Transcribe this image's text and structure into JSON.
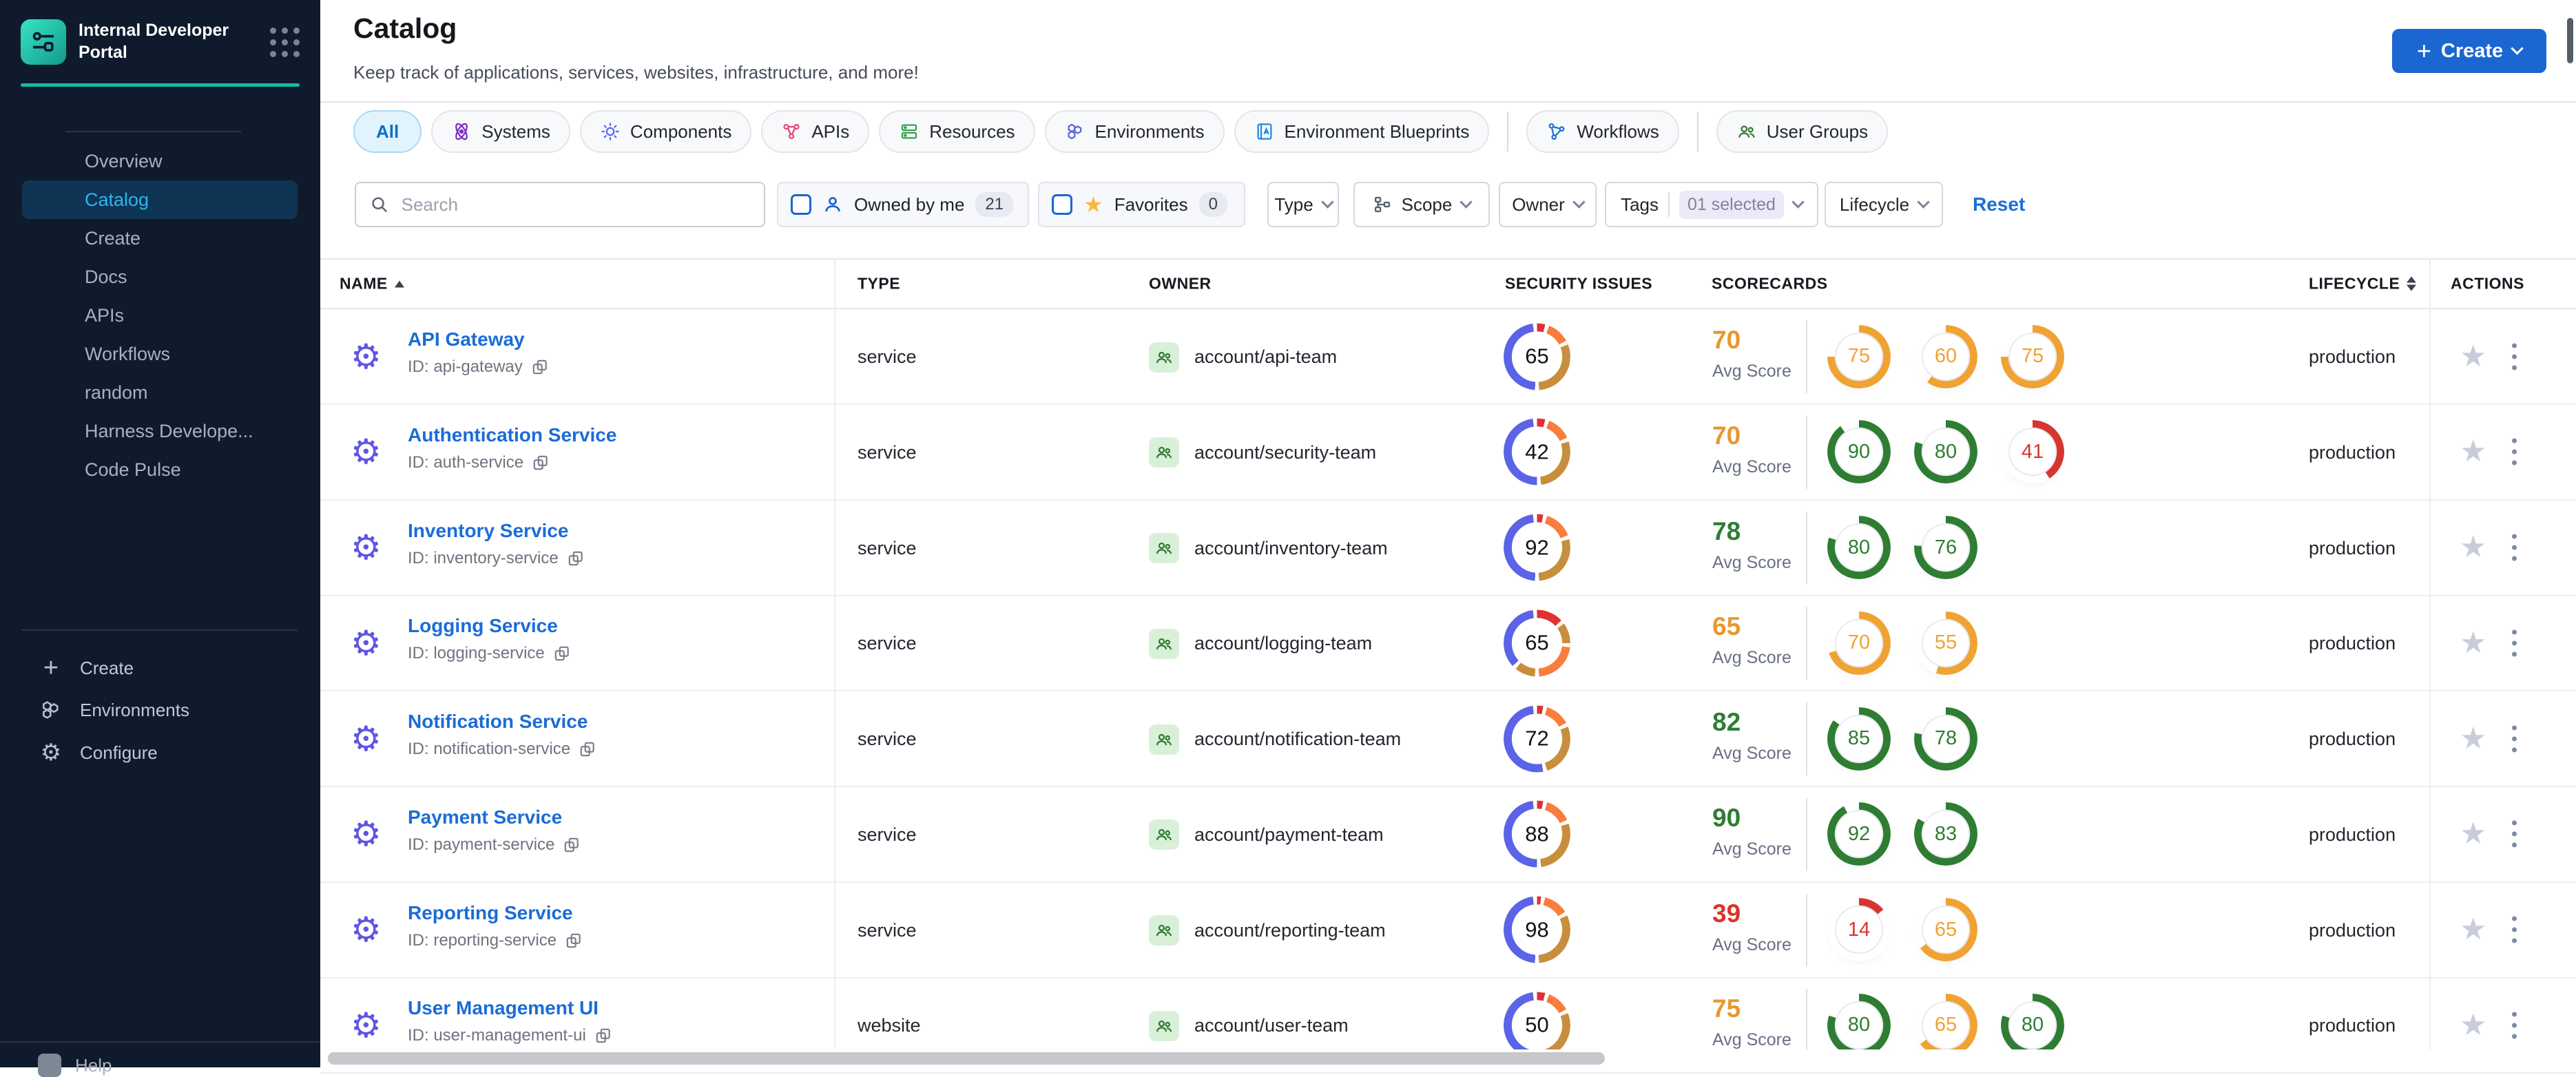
{
  "sidebar": {
    "logo_title": "Internal Developer Portal",
    "nav": [
      {
        "label": "Overview",
        "active": false
      },
      {
        "label": "Catalog",
        "active": true
      },
      {
        "label": "Create",
        "active": false
      },
      {
        "label": "Docs",
        "active": false
      },
      {
        "label": "APIs",
        "active": false
      },
      {
        "label": "Workflows",
        "active": false
      },
      {
        "label": "random",
        "active": false
      },
      {
        "label": "Harness Develope...",
        "active": false
      },
      {
        "label": "Code Pulse",
        "active": false
      }
    ],
    "bottom": [
      {
        "label": "Create",
        "icon": "plus-icon"
      },
      {
        "label": "Environments",
        "icon": "hexagons-icon"
      },
      {
        "label": "Configure",
        "icon": "gear-icon"
      }
    ],
    "help_label": "Help"
  },
  "header": {
    "title": "Catalog",
    "subtitle": "Keep track of applications, services, websites, infrastructure, and more!",
    "create_button": "Create"
  },
  "tabs": [
    {
      "label": "All",
      "active": true
    },
    {
      "label": "Systems",
      "icon": "systems-icon",
      "color": "#7b2fbf"
    },
    {
      "label": "Components",
      "icon": "components-icon",
      "color": "#5865f2"
    },
    {
      "label": "APIs",
      "icon": "apis-icon",
      "color": "#e8457c"
    },
    {
      "label": "Resources",
      "icon": "resources-icon",
      "color": "#34a24f"
    },
    {
      "label": "Environments",
      "icon": "environments-icon",
      "color": "#5a67d8"
    },
    {
      "label": "Environment Blueprints",
      "icon": "blueprints-icon",
      "color": "#1e88e5"
    },
    {
      "label": "Workflows",
      "icon": "workflows-icon",
      "color": "#1e6fd9",
      "divider_before": true
    },
    {
      "label": "User Groups",
      "icon": "user-groups-icon",
      "color": "#2f7d32",
      "divider_before": true
    }
  ],
  "filters": {
    "search_placeholder": "Search",
    "owned_by_me": {
      "label": "Owned by me",
      "count": "21"
    },
    "favorites": {
      "label": "Favorites",
      "count": "0"
    },
    "dropdowns": [
      {
        "label": "Type"
      },
      {
        "label": "Scope"
      },
      {
        "label": "Owner"
      },
      {
        "label": "Tags",
        "value": "01 selected"
      },
      {
        "label": "Lifecycle"
      }
    ],
    "reset_label": "Reset"
  },
  "table": {
    "columns": [
      "NAME",
      "TYPE",
      "OWNER",
      "SECURITY ISSUES",
      "SCORECARDS",
      "LIFECYCLE",
      "ACTIONS"
    ],
    "avg_label": "Avg Score",
    "rows": [
      {
        "name": "API Gateway",
        "id_text": "ID: api-gateway",
        "type": "service",
        "owner": "account/api-team",
        "security": {
          "issues": "65",
          "segments": [
            [
              "#e03131",
              4
            ],
            [
              "#f97d3c",
              11
            ],
            [
              "#c78f3d",
              30
            ],
            [
              "#5b63e6",
              47
            ]
          ]
        },
        "scorecards": {
          "avg": "70",
          "avg_color": "#e8982e",
          "gauges": [
            {
              "v": 75,
              "c": "#f0a232"
            },
            {
              "v": 60,
              "c": "#f0a232"
            },
            {
              "v": 75,
              "c": "#f0a232"
            }
          ]
        },
        "lifecycle": "production"
      },
      {
        "name": "Authentication Service",
        "id_text": "ID: auth-service",
        "type": "service",
        "owner": "account/security-team",
        "security": {
          "issues": "42",
          "segments": [
            [
              "#e03131",
              4
            ],
            [
              "#f97d3c",
              12
            ],
            [
              "#c78f3d",
              28
            ],
            [
              "#5b63e6",
              48
            ]
          ]
        },
        "scorecards": {
          "avg": "70",
          "avg_color": "#e8982e",
          "gauges": [
            {
              "v": 90,
              "c": "#2e7d32"
            },
            {
              "v": 80,
              "c": "#2e7d32"
            },
            {
              "v": 41,
              "c": "#d7352e"
            }
          ]
        },
        "lifecycle": "production"
      },
      {
        "name": "Inventory Service",
        "id_text": "ID: inventory-service",
        "type": "service",
        "owner": "account/inventory-team",
        "security": {
          "issues": "92",
          "segments": [
            [
              "#e03131",
              3
            ],
            [
              "#f97d3c",
              14
            ],
            [
              "#c78f3d",
              28
            ],
            [
              "#5b63e6",
              47
            ]
          ]
        },
        "scorecards": {
          "avg": "78",
          "avg_color": "#2e7d32",
          "gauges": [
            {
              "v": 80,
              "c": "#2e7d32"
            },
            {
              "v": 76,
              "c": "#2e7d32"
            }
          ]
        },
        "lifecycle": "production"
      },
      {
        "name": "Logging Service",
        "id_text": "ID: logging-service",
        "type": "service",
        "owner": "account/logging-team",
        "security": {
          "issues": "65",
          "segments": [
            [
              "#e03131",
              13
            ],
            [
              "#c78f3d",
              10
            ],
            [
              "#f97d3c",
              22
            ],
            [
              "#c78f3d",
              10
            ],
            [
              "#5b63e6",
              35
            ]
          ]
        },
        "scorecards": {
          "avg": "65",
          "avg_color": "#e8982e",
          "gauges": [
            {
              "v": 70,
              "c": "#f0a232"
            },
            {
              "v": 55,
              "c": "#f0a232"
            }
          ]
        },
        "lifecycle": "production"
      },
      {
        "name": "Notification Service",
        "id_text": "ID: notification-service",
        "type": "service",
        "owner": "account/notification-team",
        "security": {
          "issues": "72",
          "segments": [
            [
              "#e03131",
              3
            ],
            [
              "#f97d3c",
              12
            ],
            [
              "#c78f3d",
              26
            ],
            [
              "#5b63e6",
              51
            ]
          ]
        },
        "scorecards": {
          "avg": "82",
          "avg_color": "#2e7d32",
          "gauges": [
            {
              "v": 85,
              "c": "#2e7d32"
            },
            {
              "v": 78,
              "c": "#2e7d32"
            }
          ]
        },
        "lifecycle": "production"
      },
      {
        "name": "Payment Service",
        "id_text": "ID: payment-service",
        "type": "service",
        "owner": "account/payment-team",
        "security": {
          "issues": "88",
          "segments": [
            [
              "#e03131",
              3
            ],
            [
              "#f97d3c",
              13
            ],
            [
              "#c78f3d",
              28
            ],
            [
              "#5b63e6",
              48
            ]
          ]
        },
        "scorecards": {
          "avg": "90",
          "avg_color": "#2e7d32",
          "gauges": [
            {
              "v": 92,
              "c": "#2e7d32"
            },
            {
              "v": 83,
              "c": "#2e7d32"
            }
          ]
        },
        "lifecycle": "production"
      },
      {
        "name": "Reporting Service",
        "id_text": "ID: reporting-service",
        "type": "service",
        "owner": "account/reporting-team",
        "security": {
          "issues": "98",
          "segments": [
            [
              "#e03131",
              2
            ],
            [
              "#f97d3c",
              12
            ],
            [
              "#c78f3d",
              31
            ],
            [
              "#5b63e6",
              47
            ]
          ]
        },
        "scorecards": {
          "avg": "39",
          "avg_color": "#d93428",
          "gauges": [
            {
              "v": 14,
              "c": "#d7352e"
            },
            {
              "v": 65,
              "c": "#f0a232"
            }
          ]
        },
        "lifecycle": "production"
      },
      {
        "name": "User Management UI",
        "id_text": "ID: user-management-ui",
        "type": "website",
        "owner": "account/user-team",
        "security": {
          "issues": "50",
          "segments": [
            [
              "#e03131",
              4
            ],
            [
              "#f97d3c",
              11
            ],
            [
              "#c78f3d",
              31
            ],
            [
              "#5b63e6",
              46
            ]
          ]
        },
        "scorecards": {
          "avg": "75",
          "avg_color": "#e8982e",
          "gauges": [
            {
              "v": 80,
              "c": "#2e7d32"
            },
            {
              "v": 65,
              "c": "#f0a232"
            },
            {
              "v": 80,
              "c": "#2e7d32"
            }
          ]
        },
        "lifecycle": "production"
      }
    ]
  }
}
